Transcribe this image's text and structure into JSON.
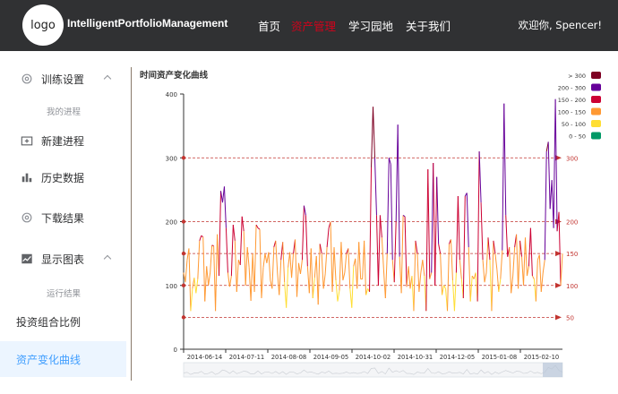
{
  "header": {
    "logo_text": "logo",
    "brand": "IntelligentPortfolioManagement",
    "nav": [
      "首页",
      "资产管理",
      "学习园地",
      "关于我们"
    ],
    "active_nav": 1,
    "welcome": "欢迎你, Spencer!"
  },
  "sidebar": {
    "items": [
      {
        "label": "训练设置",
        "icon": "gear-icon"
      },
      {
        "label": "我的进程"
      },
      {
        "label": "新建进程",
        "icon": "folder-add-icon"
      },
      {
        "label": "历史数据",
        "icon": "bar-chart-icon"
      },
      {
        "label": "下载结果",
        "icon": "gear-icon"
      },
      {
        "label": "显示图表",
        "icon": "line-chart-icon"
      },
      {
        "label": "运行结果"
      },
      {
        "label": "投资组合比例"
      },
      {
        "label": "资产变化曲线"
      }
    ]
  },
  "accent_color": "#409eff",
  "chart_data": {
    "type": "line",
    "title": "时间资产变化曲线",
    "x_tick_labels": [
      "2014-06-14",
      "2014-07-11",
      "2014-08-08",
      "2014-09-05",
      "2014-10-02",
      "2014-10-31",
      "2014-12-05",
      "2015-01-08",
      "2015-02-10"
    ],
    "ylim": [
      0,
      400
    ],
    "y_ticks": [
      0,
      100,
      200,
      300,
      400
    ],
    "mark_lines": [
      50,
      100,
      150,
      200,
      300
    ],
    "visual_map": [
      {
        "label": "> 300",
        "color": "#7e0023"
      },
      {
        "label": "200 - 300",
        "color": "#660099"
      },
      {
        "label": "150 - 200",
        "color": "#cc0033"
      },
      {
        "label": "100 - 150",
        "color": "#ff9933"
      },
      {
        "label": "50 - 100",
        "color": "#ffde33"
      },
      {
        "label": "0 - 50",
        "color": "#096"
      }
    ],
    "values": [
      120,
      105,
      140,
      158,
      60,
      95,
      112,
      88,
      110,
      170,
      178,
      176,
      75,
      130,
      100,
      120,
      163,
      162,
      60,
      180,
      115,
      248,
      230,
      255,
      190,
      120,
      98,
      115,
      195,
      170,
      90,
      140,
      132,
      208,
      185,
      100,
      160,
      128,
      76,
      150,
      90,
      195,
      190,
      188,
      80,
      128,
      150,
      135,
      152,
      108,
      95,
      160,
      170,
      120,
      85,
      140,
      168,
      105,
      65,
      128,
      152,
      112,
      150,
      172,
      82,
      135,
      118,
      140,
      225,
      210,
      130,
      88,
      158,
      80,
      112,
      146,
      70,
      165,
      150,
      95,
      118,
      160,
      190,
      200,
      90,
      160,
      108,
      75,
      92,
      168,
      108,
      120,
      150,
      158,
      95,
      65,
      130,
      142,
      95,
      168,
      110,
      110,
      170,
      85,
      95,
      90,
      285,
      380,
      300,
      210,
      100,
      210,
      175,
      125,
      80,
      150,
      300,
      290,
      140,
      105,
      200,
      352,
      145,
      88,
      210,
      208,
      98,
      130,
      95,
      115,
      60,
      170,
      150,
      90,
      120,
      140,
      115,
      60,
      282,
      110,
      120,
      292,
      100,
      270,
      165,
      150,
      85,
      100,
      95,
      60,
      165,
      172,
      108,
      60,
      120,
      240,
      140,
      110,
      80,
      240,
      245,
      160,
      75,
      115,
      110,
      120,
      75,
      310,
      230,
      140,
      105,
      120,
      175,
      140,
      60,
      170,
      150,
      125,
      90,
      110,
      155,
      385,
      210,
      145,
      160,
      88,
      115,
      160,
      180,
      95,
      170,
      145,
      100,
      175,
      115,
      130,
      190,
      115,
      110,
      75,
      140,
      148,
      90,
      120,
      140,
      310,
      325,
      220,
      265,
      190,
      392,
      185,
      215,
      100,
      150
    ]
  }
}
